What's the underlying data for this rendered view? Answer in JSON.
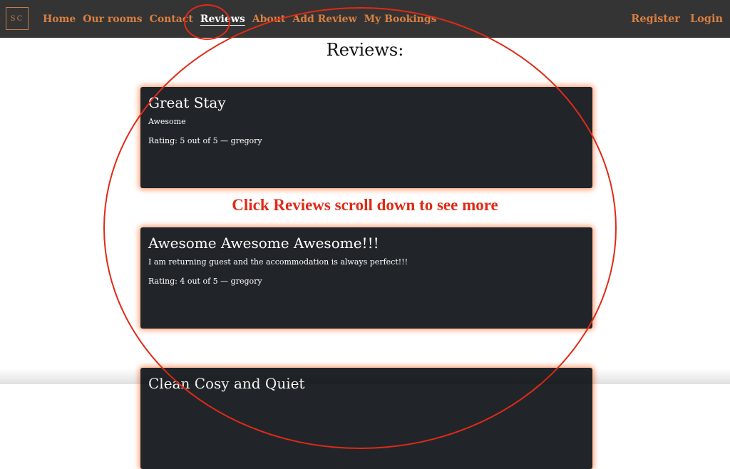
{
  "nav": {
    "logo": "SC",
    "links": [
      "Home",
      "Our rooms",
      "Contact",
      "Reviews",
      "About",
      "Add Review",
      "My Bookings"
    ],
    "active_link": "Reviews",
    "register": "Register",
    "login": "Login"
  },
  "page": {
    "heading": "Reviews:"
  },
  "reviews": [
    {
      "title": "Great Stay",
      "text": "Awesome",
      "rating": "Rating: 5 out of 5 — gregory"
    },
    {
      "title": "Awesome Awesome Awesome!!!",
      "text": "I am returning guest and the accommodation is always perfect!!!",
      "rating": "Rating: 4 out of 5 — gregory"
    },
    {
      "title": "Clean Cosy and Quiet",
      "text": "",
      "rating": ""
    }
  ],
  "annotation": {
    "text": "Click Reviews scroll down to see more",
    "color": "#e02a16"
  },
  "colors": {
    "navbar_bg": "#343434",
    "nav_link": "#d97f42",
    "card_bg": "#212529",
    "card_glow": "#ff783c"
  }
}
